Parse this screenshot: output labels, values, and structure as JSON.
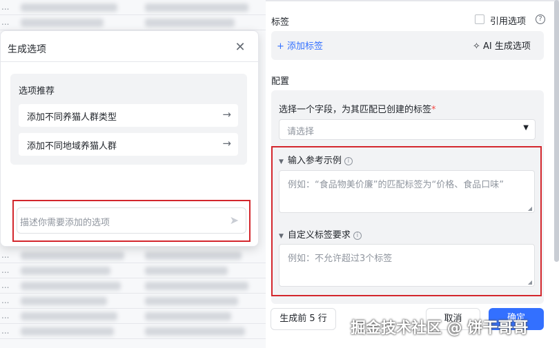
{
  "dialog": {
    "title": "生成选项",
    "recommend_title": "选项推荐",
    "recommendations": [
      {
        "label": "添加不同养猫人群类型"
      },
      {
        "label": "添加不同地域养猫人群"
      }
    ],
    "prompt_placeholder": "描述你需要添加的选项"
  },
  "panel": {
    "tag_label": "标签",
    "cite_option": "引用选项",
    "add_tag": "+ 添加标签",
    "ai_generate": "AI 生成选项",
    "config_label": "配置",
    "field_label": "选择一个字段，为其匹配已创建的标签",
    "required_mark": "*",
    "select_placeholder": "请选择",
    "example_title": "输入参考示例",
    "example_placeholder": "例如：“食品物美价廉”的匹配标签为“价格、食品口味”",
    "custom_title": "自定义标签要求",
    "custom_placeholder": "例如：不允许超过3个标签"
  },
  "footer": {
    "generate_prev": "生成前 5 行",
    "cancel": "取消",
    "confirm": "确定"
  },
  "watermark": "掘金技术社区 @ 饼干哥哥"
}
